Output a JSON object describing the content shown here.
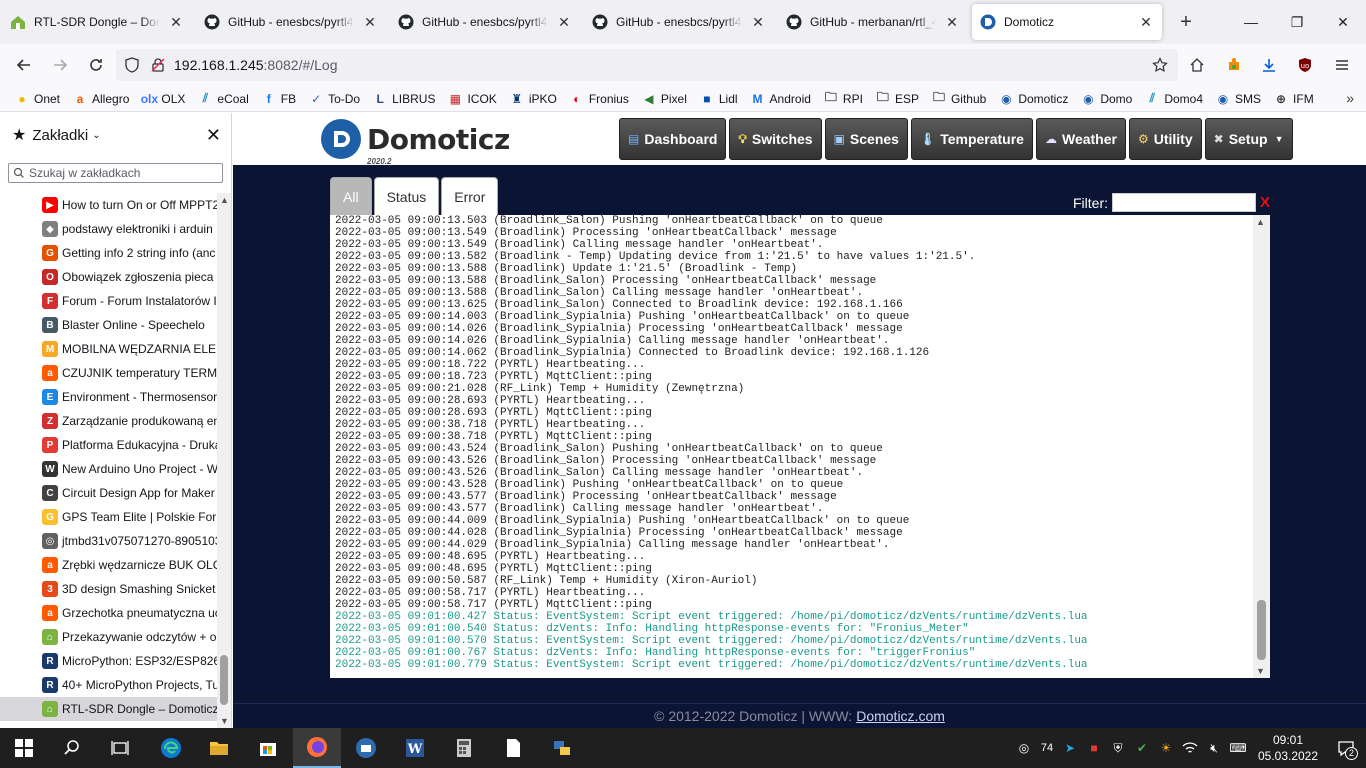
{
  "browser": {
    "tabs": [
      {
        "label": "RTL-SDR Dongle – Domoticz",
        "icon": "domoticz-green-icon",
        "active": false
      },
      {
        "label": "GitHub - enesbcs/pyrtl433",
        "icon": "github-icon",
        "active": false
      },
      {
        "label": "GitHub - enesbcs/pyrtl433",
        "icon": "github-icon",
        "active": false
      },
      {
        "label": "GitHub - enesbcs/pyrtl433",
        "icon": "github-icon",
        "active": false
      },
      {
        "label": "GitHub - merbanan/rtl_433",
        "icon": "github-icon",
        "active": false
      },
      {
        "label": "Domoticz",
        "icon": "domoticz-icon",
        "active": true
      }
    ],
    "url_host": "192.168.1.245",
    "url_rest": ":8082/#/Log",
    "bookmarks": [
      {
        "label": "Onet",
        "icon": "onet-icon",
        "color": "#f2b705"
      },
      {
        "label": "Allegro",
        "icon": "allegro-icon",
        "color": "#ff5a00"
      },
      {
        "label": "OLX",
        "icon": "olx-icon",
        "color": "#3a77ff"
      },
      {
        "label": "eCoal",
        "icon": "ecoal-icon",
        "color": "#1e8ecb"
      },
      {
        "label": "FB",
        "icon": "facebook-icon",
        "color": "#1877f2"
      },
      {
        "label": "To-Do",
        "icon": "todo-icon",
        "color": "#2564cf"
      },
      {
        "label": "LIBRUS",
        "icon": "librus-icon",
        "color": "#2e4a8a"
      },
      {
        "label": "ICOK",
        "icon": "icok-icon",
        "color": "#c62828"
      },
      {
        "label": "iPKO",
        "icon": "ipko-icon",
        "color": "#003574"
      },
      {
        "label": "Fronius",
        "icon": "fronius-icon",
        "color": "#e2001a"
      },
      {
        "label": "Pixel",
        "icon": "pixel-icon",
        "color": "#2e7d32"
      },
      {
        "label": "Lidl",
        "icon": "lidl-icon",
        "color": "#0050aa"
      },
      {
        "label": "Android",
        "icon": "android-icon",
        "color": "#1a73e8"
      },
      {
        "label": "RPI",
        "icon": "folder-icon",
        "color": "#333333"
      },
      {
        "label": "ESP",
        "icon": "folder-icon",
        "color": "#333333"
      },
      {
        "label": "Github",
        "icon": "folder-icon",
        "color": "#333333"
      },
      {
        "label": "Domoticz",
        "icon": "domoticz-icon",
        "color": "#1e5fa8"
      },
      {
        "label": "Domo",
        "icon": "domoticz-icon",
        "color": "#1e5fa8"
      },
      {
        "label": "Domo4",
        "icon": "ecoal-icon",
        "color": "#1e8ecb"
      },
      {
        "label": "SMS",
        "icon": "sms-icon",
        "color": "#1e5fa8"
      },
      {
        "label": "IFM",
        "icon": "globe-icon",
        "color": "#333333"
      }
    ]
  },
  "sidebar": {
    "title": "Zakładki",
    "search_placeholder": "Szukaj w zakładkach",
    "items": [
      {
        "label": "How to turn On or Off MPPT2",
        "color": "#ff0000",
        "glyph": "▶"
      },
      {
        "label": "podstawy elektroniki i arduin",
        "color": "#7f7f7f",
        "glyph": "◆"
      },
      {
        "label": "Getting info 2 string info (anc",
        "color": "#e65100",
        "glyph": "G"
      },
      {
        "label": "Obowiązek zgłoszenia pieca d",
        "color": "#c62828",
        "glyph": "O"
      },
      {
        "label": "Forum - Forum Instalatorów I",
        "color": "#d32f2f",
        "glyph": "F"
      },
      {
        "label": "Blaster Online - Speechelo",
        "color": "#455a64",
        "glyph": "B"
      },
      {
        "label": "MOBILNA WĘDZARNIA ELEKT",
        "color": "#f9a825",
        "glyph": "M"
      },
      {
        "label": "CZUJNIK temperatury TERMO",
        "color": "#ff5a00",
        "glyph": "a"
      },
      {
        "label": "Environment - Thermosensor",
        "color": "#1e88e5",
        "glyph": "E"
      },
      {
        "label": "Zarządzanie produkowaną en",
        "color": "#d32f2f",
        "glyph": "Z"
      },
      {
        "label": "Platforma Edukacyjna - Druka",
        "color": "#e53935",
        "glyph": "P"
      },
      {
        "label": "New Arduino Uno Project - W",
        "color": "#333333",
        "glyph": "W"
      },
      {
        "label": "Circuit Design App for Maker",
        "color": "#424242",
        "glyph": "C"
      },
      {
        "label": "GPS Team Elite | Polskie Forun",
        "color": "#fbc02d",
        "glyph": "G"
      },
      {
        "label": "jtmbd31v075071270-89051030",
        "color": "#616161",
        "glyph": "◎"
      },
      {
        "label": "Zrębki wędzarnicze BUK OLC.",
        "color": "#ff5a00",
        "glyph": "a"
      },
      {
        "label": "3D design Smashing Snicket |",
        "color": "#e64a19",
        "glyph": "3"
      },
      {
        "label": "Grzechotka pneumatyczna uc",
        "color": "#ff5a00",
        "glyph": "a"
      },
      {
        "label": "Przekazywanie odczytów + ob",
        "color": "#7cb342",
        "glyph": "⌂"
      },
      {
        "label": "MicroPython: ESP32/ESP8266",
        "color": "#1a3a6b",
        "glyph": "R"
      },
      {
        "label": "40+ MicroPython Projects, Tu",
        "color": "#1a3a6b",
        "glyph": "R"
      },
      {
        "label": "RTL-SDR Dongle – Domoticz -",
        "color": "#7cb342",
        "glyph": "⌂",
        "selected": true
      }
    ]
  },
  "domoticz": {
    "brand": "Domoticz",
    "version": "2020.2",
    "menu": [
      {
        "label": "Dashboard",
        "icon": "dashboard-icon"
      },
      {
        "label": "Switches",
        "icon": "lightbulb-icon"
      },
      {
        "label": "Scenes",
        "icon": "scenes-icon"
      },
      {
        "label": "Temperature",
        "icon": "thermometer-icon"
      },
      {
        "label": "Weather",
        "icon": "weather-icon"
      },
      {
        "label": "Utility",
        "icon": "utility-icon"
      },
      {
        "label": "Setup",
        "icon": "setup-icon"
      }
    ],
    "log_tabs": [
      "All",
      "Status",
      "Error"
    ],
    "selected_tab": "All",
    "filter_label": "Filter:",
    "filter_clear": "X",
    "footer_text": "© 2012-2022 Domoticz | WWW:",
    "footer_link": "Domoticz.com",
    "log": [
      {
        "text": "2022-03-05 09:00:13.503 (Broadlink_Salon) Pushing 'onHeartbeatCallback' on to queue",
        "type": "normal"
      },
      {
        "text": "2022-03-05 09:00:13.549 (Broadlink) Processing 'onHeartbeatCallback' message",
        "type": "normal"
      },
      {
        "text": "2022-03-05 09:00:13.549 (Broadlink) Calling message handler 'onHeartbeat'.",
        "type": "normal"
      },
      {
        "text": "2022-03-05 09:00:13.582 (Broadlink - Temp) Updating device from 1:'21.5' to have values 1:'21.5'.",
        "type": "normal"
      },
      {
        "text": "2022-03-05 09:00:13.588 (Broadlink) Update 1:'21.5' (Broadlink - Temp)",
        "type": "normal"
      },
      {
        "text": "2022-03-05 09:00:13.588 (Broadlink_Salon) Processing 'onHeartbeatCallback' message",
        "type": "normal"
      },
      {
        "text": "2022-03-05 09:00:13.588 (Broadlink_Salon) Calling message handler 'onHeartbeat'.",
        "type": "normal"
      },
      {
        "text": "2022-03-05 09:00:13.625 (Broadlink_Salon) Connected to Broadlink device: 192.168.1.166",
        "type": "normal"
      },
      {
        "text": "2022-03-05 09:00:14.003 (Broadlink_Sypialnia) Pushing 'onHeartbeatCallback' on to queue",
        "type": "normal"
      },
      {
        "text": "2022-03-05 09:00:14.026 (Broadlink_Sypialnia) Processing 'onHeartbeatCallback' message",
        "type": "normal"
      },
      {
        "text": "2022-03-05 09:00:14.026 (Broadlink_Sypialnia) Calling message handler 'onHeartbeat'.",
        "type": "normal"
      },
      {
        "text": "2022-03-05 09:00:14.062 (Broadlink_Sypialnia) Connected to Broadlink device: 192.168.1.126",
        "type": "normal"
      },
      {
        "text": "2022-03-05 09:00:18.722 (PYRTL) Heartbeating...",
        "type": "normal"
      },
      {
        "text": "2022-03-05 09:00:18.723 (PYRTL) MqttClient::ping",
        "type": "normal"
      },
      {
        "text": "2022-03-05 09:00:21.028 (RF_Link) Temp + Humidity (Zewnętrzna)",
        "type": "normal"
      },
      {
        "text": "2022-03-05 09:00:28.693 (PYRTL) Heartbeating...",
        "type": "normal"
      },
      {
        "text": "2022-03-05 09:00:28.693 (PYRTL) MqttClient::ping",
        "type": "normal"
      },
      {
        "text": "2022-03-05 09:00:38.718 (PYRTL) Heartbeating...",
        "type": "normal"
      },
      {
        "text": "2022-03-05 09:00:38.718 (PYRTL) MqttClient::ping",
        "type": "normal"
      },
      {
        "text": "2022-03-05 09:00:43.524 (Broadlink_Salon) Pushing 'onHeartbeatCallback' on to queue",
        "type": "normal"
      },
      {
        "text": "2022-03-05 09:00:43.526 (Broadlink_Salon) Processing 'onHeartbeatCallback' message",
        "type": "normal"
      },
      {
        "text": "2022-03-05 09:00:43.526 (Broadlink_Salon) Calling message handler 'onHeartbeat'.",
        "type": "normal"
      },
      {
        "text": "2022-03-05 09:00:43.528 (Broadlink) Pushing 'onHeartbeatCallback' on to queue",
        "type": "normal"
      },
      {
        "text": "2022-03-05 09:00:43.577 (Broadlink) Processing 'onHeartbeatCallback' message",
        "type": "normal"
      },
      {
        "text": "2022-03-05 09:00:43.577 (Broadlink) Calling message handler 'onHeartbeat'.",
        "type": "normal"
      },
      {
        "text": "2022-03-05 09:00:44.009 (Broadlink_Sypialnia) Pushing 'onHeartbeatCallback' on to queue",
        "type": "normal"
      },
      {
        "text": "2022-03-05 09:00:44.028 (Broadlink_Sypialnia) Processing 'onHeartbeatCallback' message",
        "type": "normal"
      },
      {
        "text": "2022-03-05 09:00:44.029 (Broadlink_Sypialnia) Calling message handler 'onHeartbeat'.",
        "type": "normal"
      },
      {
        "text": "2022-03-05 09:00:48.695 (PYRTL) Heartbeating...",
        "type": "normal"
      },
      {
        "text": "2022-03-05 09:00:48.695 (PYRTL) MqttClient::ping",
        "type": "normal"
      },
      {
        "text": "2022-03-05 09:00:50.587 (RF_Link) Temp + Humidity (Xiron-Auriol)",
        "type": "normal"
      },
      {
        "text": "2022-03-05 09:00:58.717 (PYRTL) Heartbeating...",
        "type": "normal"
      },
      {
        "text": "2022-03-05 09:00:58.717 (PYRTL) MqttClient::ping",
        "type": "normal"
      },
      {
        "text": "2022-03-05 09:01:00.427 Status: EventSystem: Script event triggered: /home/pi/domoticz/dzVents/runtime/dzVents.lua",
        "type": "status"
      },
      {
        "text": "2022-03-05 09:01:00.540 Status: dzVents: Info: Handling httpResponse-events for: \"Fronius_Meter\"",
        "type": "status"
      },
      {
        "text": "2022-03-05 09:01:00.570 Status: EventSystem: Script event triggered: /home/pi/domoticz/dzVents/runtime/dzVents.lua",
        "type": "status"
      },
      {
        "text": "2022-03-05 09:01:00.767 Status: dzVents: Info: Handling httpResponse-events for: \"triggerFronius\"",
        "type": "status"
      },
      {
        "text": "2022-03-05 09:01:00.779 Status: EventSystem: Script event triggered: /home/pi/domoticz/dzVents/runtime/dzVents.lua",
        "type": "status"
      }
    ]
  },
  "taskbar": {
    "tray_number": "74",
    "time": "09:01",
    "date": "05.03.2022",
    "notifications": "2"
  }
}
